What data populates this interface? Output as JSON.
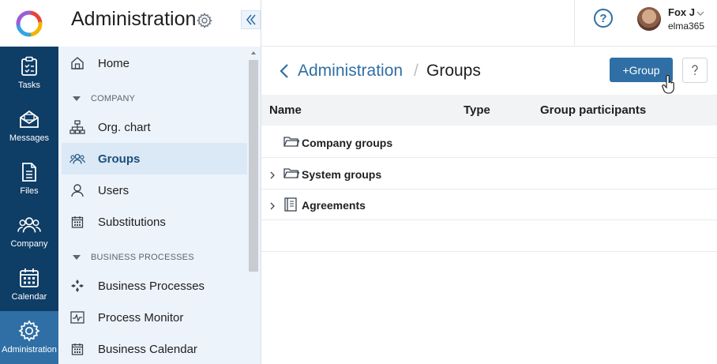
{
  "rail": {
    "items": [
      {
        "label": "Tasks",
        "icon": "clipboard-icon"
      },
      {
        "label": "Messages",
        "icon": "envelope-icon"
      },
      {
        "label": "Files",
        "icon": "file-icon"
      },
      {
        "label": "Company",
        "icon": "people-icon"
      },
      {
        "label": "Calendar",
        "icon": "calendar-icon"
      },
      {
        "label": "Administration",
        "icon": "gear-icon",
        "active": true
      }
    ]
  },
  "sidebar": {
    "title": "Administration",
    "items": [
      {
        "label": "Home",
        "icon": "home-icon"
      },
      {
        "label": "Org. chart",
        "icon": "org-chart-icon"
      },
      {
        "label": "Groups",
        "icon": "group-icon",
        "active": true
      },
      {
        "label": "Users",
        "icon": "user-icon"
      },
      {
        "label": "Substitutions",
        "icon": "calendar-icon"
      },
      {
        "label": "Business Processes",
        "icon": "process-icon"
      },
      {
        "label": "Process Monitor",
        "icon": "monitor-icon"
      },
      {
        "label": "Business Calendar",
        "icon": "calendar-icon"
      }
    ],
    "sections": [
      "COMPANY",
      "BUSINESS PROCESSES"
    ]
  },
  "header": {
    "help": "?",
    "user_name": "Fox J",
    "user_org": "elma365"
  },
  "page": {
    "breadcrumb_parent": "Administration",
    "breadcrumb_sep": "/",
    "breadcrumb_current": "Groups",
    "add_button": "+Group",
    "help_button": "?"
  },
  "table": {
    "columns": [
      "Name",
      "Type",
      "Group participants"
    ],
    "rows": [
      {
        "name": "Company groups",
        "icon": "folder-icon",
        "expandable": false
      },
      {
        "name": "System groups",
        "icon": "folder-icon",
        "expandable": true
      },
      {
        "name": "Agreements",
        "icon": "book-icon",
        "expandable": true
      }
    ]
  },
  "colors": {
    "rail_bg": "#0e3d66",
    "accent": "#2f6fa5",
    "sidebar_bg": "#ecf3fb"
  }
}
